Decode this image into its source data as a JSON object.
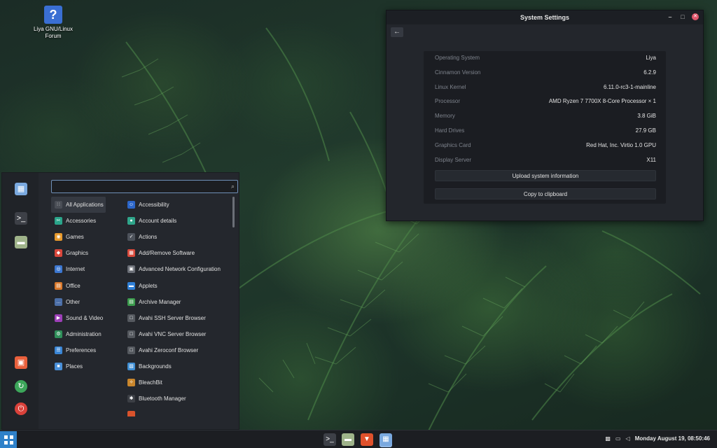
{
  "desktop": {
    "icon_label": "Liya GNU/Linux\nForum",
    "icon_glyph": "?"
  },
  "window": {
    "title": "System Settings",
    "back_glyph": "←",
    "minimize_glyph": "–",
    "maximize_glyph": "□",
    "close_glyph": "✕",
    "info": [
      {
        "key": "Operating System",
        "value": "Liya"
      },
      {
        "key": "Cinnamon Version",
        "value": "6.2.9"
      },
      {
        "key": "Linux Kernel",
        "value": "6.11.0-rc3-1-mainline"
      },
      {
        "key": "Processor",
        "value": "AMD Ryzen 7 7700X 8-Core Processor × 1"
      },
      {
        "key": "Memory",
        "value": "3.8 GiB"
      },
      {
        "key": "Hard Drives",
        "value": "27.9 GB"
      },
      {
        "key": "Graphics Card",
        "value": "Red Hat, Inc. Virtio 1.0 GPU"
      },
      {
        "key": "Display Server",
        "value": "X11"
      }
    ],
    "upload_label": "Upload system information",
    "copy_label": "Copy to clipboard"
  },
  "menu": {
    "search_value": "",
    "search_glyph": "⌕",
    "favorites": [
      {
        "name": "software-manager-icon",
        "glyph": "▦",
        "color": "#7aa9df"
      },
      {
        "name": "terminal-icon",
        "glyph": ">_",
        "color": "#3d4047"
      },
      {
        "name": "files-icon",
        "glyph": "▬",
        "color": "#9fb38a"
      }
    ],
    "session": [
      {
        "name": "lock-screen-icon",
        "glyph": "▣",
        "color": "#e9603c"
      },
      {
        "name": "logout-icon",
        "glyph": "↻",
        "color": "#3ca65a"
      },
      {
        "name": "shutdown-icon",
        "glyph": "⏻",
        "color": "#d9413a"
      }
    ],
    "categories": [
      {
        "label": "All Applications",
        "icon": "grid-icon",
        "glyph": "∷",
        "color": "#4a4e56"
      },
      {
        "label": "Accessories",
        "icon": "accessories-icon",
        "glyph": "✂",
        "color": "#2aa58a"
      },
      {
        "label": "Games",
        "icon": "games-icon",
        "glyph": "◉",
        "color": "#e89a2c"
      },
      {
        "label": "Graphics",
        "icon": "graphics-icon",
        "glyph": "◆",
        "color": "#d9473c"
      },
      {
        "label": "Internet",
        "icon": "internet-icon",
        "glyph": "◎",
        "color": "#3c77d1"
      },
      {
        "label": "Office",
        "icon": "office-icon",
        "glyph": "▤",
        "color": "#d9792c"
      },
      {
        "label": "Other",
        "icon": "other-icon",
        "glyph": "…",
        "color": "#4c6fa8"
      },
      {
        "label": "Sound & Video",
        "icon": "sound-video-icon",
        "glyph": "▶",
        "color": "#9d3fb8"
      },
      {
        "label": "Administration",
        "icon": "administration-icon",
        "glyph": "⚙",
        "color": "#2f8f5a"
      },
      {
        "label": "Preferences",
        "icon": "preferences-icon",
        "glyph": "☰",
        "color": "#3a86d6"
      },
      {
        "label": "Places",
        "icon": "places-icon",
        "glyph": "■",
        "color": "#4a90d9"
      }
    ],
    "apps": [
      {
        "label": "Accessibility",
        "icon": "accessibility-icon",
        "glyph": "☺",
        "color": "#2c66c9"
      },
      {
        "label": "Account details",
        "icon": "account-details-icon",
        "glyph": "●",
        "color": "#2fa58a"
      },
      {
        "label": "Actions",
        "icon": "actions-icon",
        "glyph": "✓",
        "color": "#4d525b"
      },
      {
        "label": "Add/Remove Software",
        "icon": "add-remove-software-icon",
        "glyph": "▦",
        "color": "#d94a3c"
      },
      {
        "label": "Advanced Network Configuration",
        "icon": "network-icon",
        "glyph": "▣",
        "color": "#6a6e76"
      },
      {
        "label": "Applets",
        "icon": "applets-icon",
        "glyph": "▬",
        "color": "#2f7fd6"
      },
      {
        "label": "Archive Manager",
        "icon": "archive-manager-icon",
        "glyph": "▤",
        "color": "#3b9a4c"
      },
      {
        "label": "Avahi SSH Server Browser",
        "icon": "avahi-ssh-icon",
        "glyph": "□",
        "color": "#55595f"
      },
      {
        "label": "Avahi VNC Server Browser",
        "icon": "avahi-vnc-icon",
        "glyph": "□",
        "color": "#55595f"
      },
      {
        "label": "Avahi Zeroconf Browser",
        "icon": "avahi-zeroconf-icon",
        "glyph": "□",
        "color": "#55595f"
      },
      {
        "label": "Backgrounds",
        "icon": "backgrounds-icon",
        "glyph": "▧",
        "color": "#3f8fd4"
      },
      {
        "label": "BleachBit",
        "icon": "bleachbit-icon",
        "glyph": "✧",
        "color": "#c9862c"
      },
      {
        "label": "Bluetooth Manager",
        "icon": "bluetooth-icon",
        "glyph": "✱",
        "color": "#3c3f45"
      },
      {
        "label": "",
        "icon": "next-app-icon",
        "glyph": "",
        "color": "#d9532c"
      }
    ]
  },
  "taskbar": {
    "apps": [
      {
        "name": "terminal-taskbar-icon",
        "glyph": ">_",
        "color": "#3d4047"
      },
      {
        "name": "files-taskbar-icon",
        "glyph": "▬",
        "color": "#9fb38a"
      },
      {
        "name": "brave-browser-icon",
        "glyph": "▼",
        "color": "#e0512c"
      },
      {
        "name": "software-manager-taskbar-icon",
        "glyph": "▦",
        "color": "#7aa9df"
      }
    ],
    "tray_glyphs": [
      "▩",
      "▭",
      "◁"
    ],
    "clock": "Monday August 19, 08:50:46"
  }
}
